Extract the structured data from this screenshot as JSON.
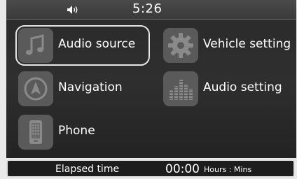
{
  "status_bar": {
    "time": "5:26",
    "volume_icon": "speaker-icon"
  },
  "menu": {
    "items": [
      {
        "label": "Audio source",
        "icon": "music-note-icon",
        "selected": true
      },
      {
        "label": "Vehicle setting",
        "icon": "gear-icon",
        "selected": false
      },
      {
        "label": "Navigation",
        "icon": "compass-icon",
        "selected": false
      },
      {
        "label": "Audio setting",
        "icon": "equalizer-icon",
        "selected": false
      },
      {
        "label": "Phone",
        "icon": "phone-icon",
        "selected": false
      }
    ]
  },
  "footer": {
    "elapsed_label": "Elapsed time",
    "elapsed_value": "00:00",
    "elapsed_unit": "Hours : Mins"
  },
  "colors": {
    "background": "#2a2a2a",
    "icon_tile": "#5a5a5a",
    "text": "#ffffff",
    "selection_border": "#e6e6e6"
  }
}
